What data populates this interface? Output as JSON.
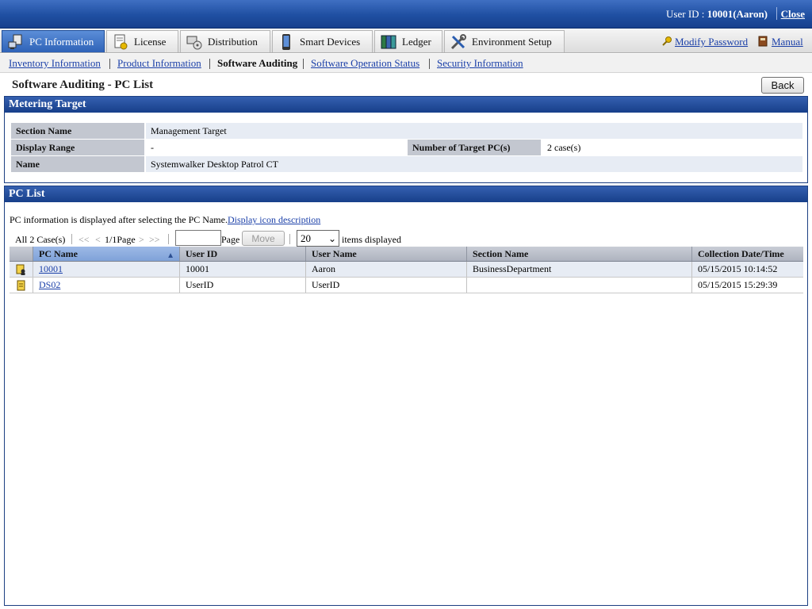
{
  "header": {
    "user_label": "User ID : ",
    "user_value": "10001(Aaron)",
    "close": "Close"
  },
  "tabs": [
    {
      "label": "PC Information",
      "icon": "pc-icon",
      "active": true
    },
    {
      "label": "License",
      "icon": "license-icon",
      "active": false
    },
    {
      "label": "Distribution",
      "icon": "distribution-icon",
      "active": false
    },
    {
      "label": "Smart Devices",
      "icon": "smartphone-icon",
      "active": false
    },
    {
      "label": "Ledger",
      "icon": "ledger-icon",
      "active": false
    },
    {
      "label": "Environment Setup",
      "icon": "tools-icon",
      "active": false
    }
  ],
  "top_links": {
    "modify_password": "Modify Password",
    "manual": "Manual"
  },
  "subnav": [
    {
      "label": "Inventory Information",
      "current": false
    },
    {
      "label": "Product Information",
      "current": false
    },
    {
      "label": "Software Auditing",
      "current": true
    },
    {
      "label": "Software Operation Status",
      "current": false
    },
    {
      "label": "Security Information",
      "current": false
    }
  ],
  "page": {
    "title": "Software Auditing - PC List",
    "back": "Back"
  },
  "metering": {
    "header": "Metering Target",
    "section_name_label": "Section Name",
    "section_name_value": "Management Target",
    "display_range_label": "Display Range",
    "display_range_value": "-",
    "target_pcs_label": "Number of Target PC(s)",
    "target_pcs_value": "2 case(s)",
    "name_label": "Name",
    "name_value": "Systemwalker Desktop Patrol CT"
  },
  "pc_list": {
    "header": "PC List",
    "info_text": "PC information is displayed after selecting the PC Name.",
    "info_link": "Display icon description",
    "pager": {
      "total": "All 2 Case(s)",
      "first": "<<",
      "prev": "<",
      "position": "1/1Page",
      "next": ">",
      "last": ">>",
      "page_input": "",
      "page_label": "Page",
      "move": "Move",
      "per_page": "20",
      "per_page_suffix": "items displayed"
    },
    "columns": [
      "PC Name",
      "User ID",
      "User Name",
      "Section Name",
      "Collection Date/Time"
    ],
    "rows": [
      {
        "icon": "pc-user-icon",
        "pc_name": "10001",
        "user_id": "10001",
        "user_name": "Aaron",
        "section": "BusinessDepartment",
        "datetime": "05/15/2015 10:14:52"
      },
      {
        "icon": "pc-icon",
        "pc_name": "DS02",
        "user_id": "UserID",
        "user_name": "UserID",
        "section": "",
        "datetime": "05/15/2015 15:29:39"
      }
    ]
  }
}
